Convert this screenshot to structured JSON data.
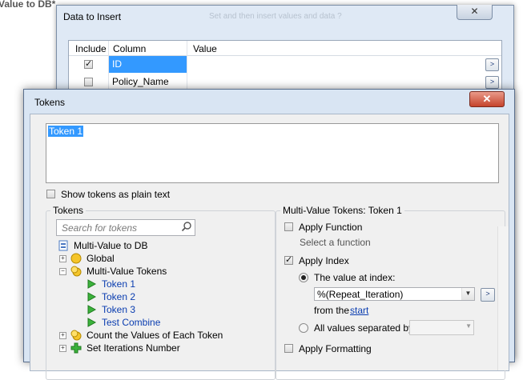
{
  "background": {
    "window_title": "Value to DB*",
    "dialog": {
      "title": "Data to Insert",
      "ghost_text": "Set and then insert values and data  ?",
      "close_label": "✕",
      "columns": [
        "Include",
        "Column",
        "Value"
      ],
      "rows": [
        {
          "include": true,
          "column": "ID",
          "selected": true,
          "button": ">"
        },
        {
          "include": false,
          "column": "Policy_Name",
          "selected": false,
          "button": ">"
        }
      ]
    }
  },
  "tokens_dialog": {
    "title": "Tokens",
    "close_label": "✕",
    "token_text": "Token 1",
    "show_plain_label": "Show tokens as plain text",
    "left_group": {
      "title": "Tokens",
      "search_placeholder": "Search for tokens",
      "tree": [
        {
          "label": "Multi-Value to DB",
          "icon": "workflow-icon",
          "level": 0
        },
        {
          "label": "Global",
          "icon": "global-token-icon",
          "level": 1,
          "expander": "+"
        },
        {
          "label": "Multi-Value Tokens",
          "icon": "multi-token-icon",
          "level": 1,
          "expander": "-"
        },
        {
          "label": "Token 1",
          "icon": "play-icon",
          "level": 2,
          "link": true
        },
        {
          "label": "Token 2",
          "icon": "play-icon",
          "level": 2,
          "link": true
        },
        {
          "label": "Token 3",
          "icon": "play-icon",
          "level": 2,
          "link": true
        },
        {
          "label": "Test Combine",
          "icon": "play-icon",
          "level": 2,
          "link": true
        },
        {
          "label": "Count the Values of Each Token",
          "icon": "count-token-icon",
          "level": 1,
          "expander": "+"
        },
        {
          "label": "Set Iterations Number",
          "icon": "plus-token-icon",
          "level": 1,
          "expander": "+"
        }
      ]
    },
    "right_group": {
      "title": "Multi-Value Tokens: Token 1",
      "apply_function_label": "Apply Function",
      "apply_function_checked": false,
      "select_function_text": "Select a function",
      "apply_index_label": "Apply Index",
      "apply_index_checked": true,
      "value_at_index_label": "The value at index:",
      "index_value": "%(Repeat_Iteration)",
      "from_the_label": "from the",
      "start_link": "start",
      "all_values_label": "All values separated by:",
      "apply_formatting_label": "Apply Formatting",
      "apply_formatting_checked": false,
      "more_button": ">"
    }
  }
}
